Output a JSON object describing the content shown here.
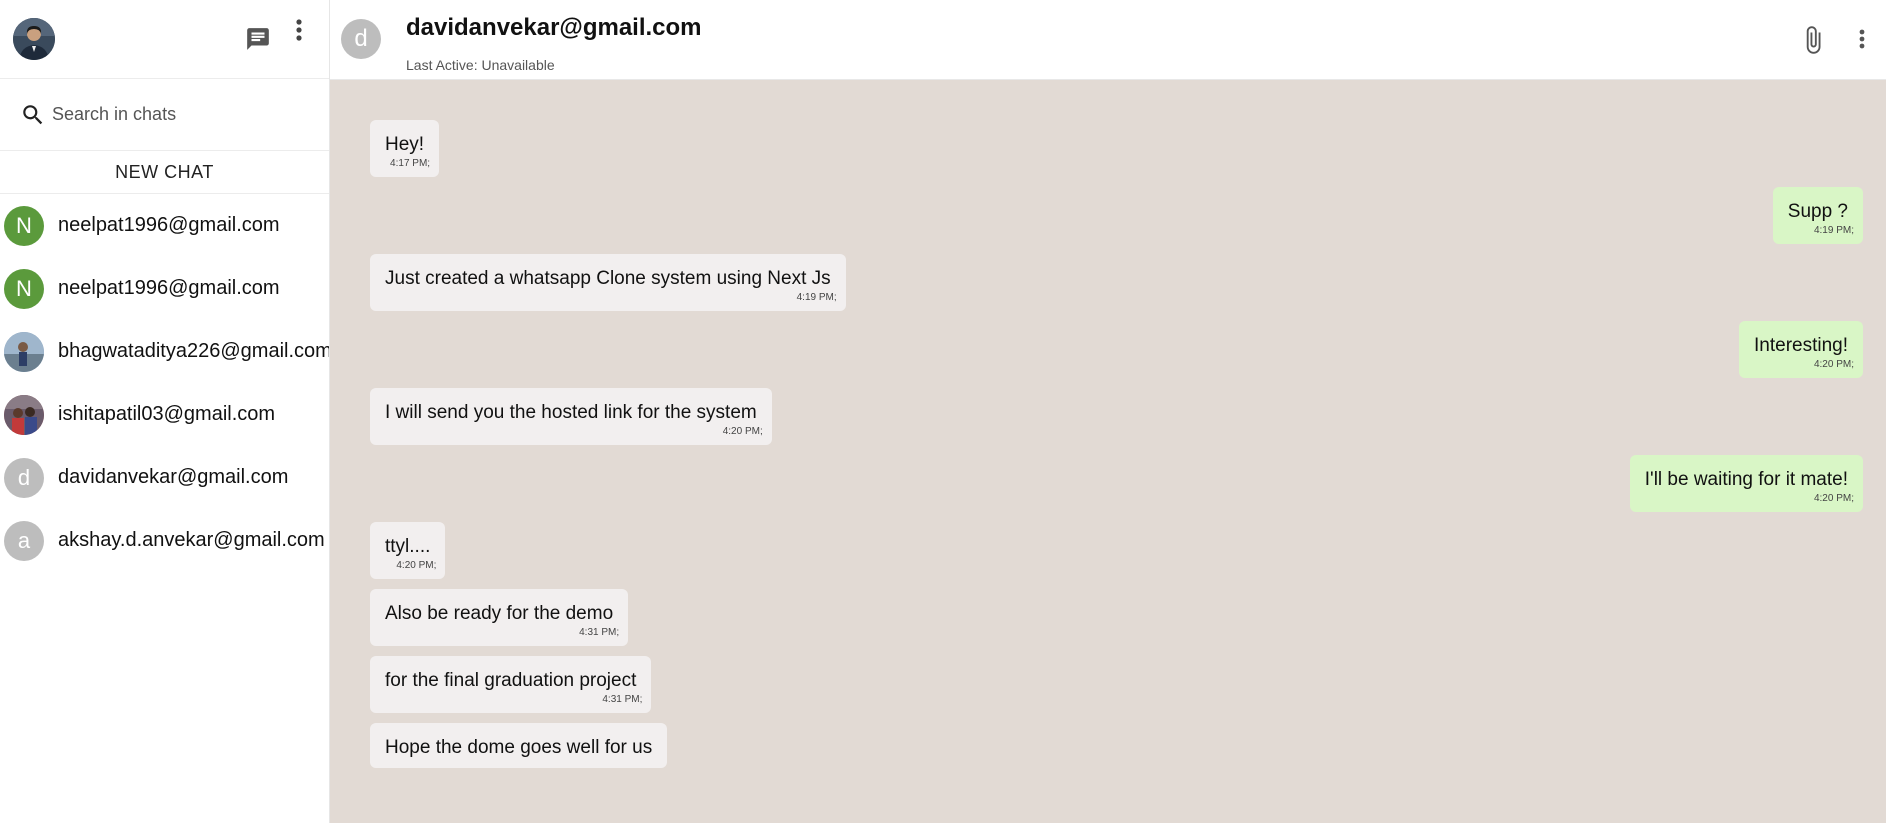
{
  "sidebar": {
    "search_placeholder": "Search in chats",
    "new_chat_label": "NEW CHAT",
    "contacts": [
      {
        "name": "neelpat1996@gmail.com",
        "initial": "N",
        "avatar_type": "letter",
        "color": "#5b9a3c"
      },
      {
        "name": "neelpat1996@gmail.com",
        "initial": "N",
        "avatar_type": "letter",
        "color": "#5b9a3c"
      },
      {
        "name": "bhagwataditya226@gmail.com",
        "initial": "",
        "avatar_type": "photo",
        "color": "#6a8cae"
      },
      {
        "name": "ishitapatil03@gmail.com",
        "initial": "",
        "avatar_type": "photo",
        "color": "#b04a4a"
      },
      {
        "name": "davidanvekar@gmail.com",
        "initial": "d",
        "avatar_type": "letter",
        "color": "#bdbdbd"
      },
      {
        "name": "akshay.d.anvekar@gmail.com",
        "initial": "a",
        "avatar_type": "letter",
        "color": "#bdbdbd"
      }
    ]
  },
  "chat": {
    "avatar_initial": "d",
    "title": "davidanvekar@gmail.com",
    "status": "Last Active: Unavailable",
    "messages": [
      {
        "dir": "in",
        "text": "Hey!",
        "time": "4:17 PM;"
      },
      {
        "dir": "out",
        "text": "Supp ?",
        "time": "4:19 PM;"
      },
      {
        "dir": "in",
        "text": "Just created a whatsapp Clone system using Next Js",
        "time": "4:19 PM;"
      },
      {
        "dir": "out",
        "text": "Interesting!",
        "time": "4:20 PM;"
      },
      {
        "dir": "in",
        "text": "I will send you the hosted link for the system",
        "time": "4:20 PM;"
      },
      {
        "dir": "out",
        "text": "I'll be waiting for it mate!",
        "time": "4:20 PM;"
      },
      {
        "dir": "in",
        "text": "ttyl....",
        "time": "4:20 PM;"
      },
      {
        "dir": "in",
        "text": "Also be ready for the demo",
        "time": "4:31 PM;"
      },
      {
        "dir": "in",
        "text": "for the final graduation project",
        "time": "4:31 PM;"
      },
      {
        "dir": "in",
        "text": "Hope the dome goes well for us",
        "time": ""
      }
    ]
  },
  "colors": {
    "chat_background": "#e2dad4",
    "incoming_bubble": "#f2efef",
    "outgoing_bubble": "#d9f6c6"
  },
  "icons": {
    "new_chat": "chat-bubble-icon",
    "more": "vertical-dots-icon",
    "search": "search-icon",
    "attach": "paperclip-icon"
  }
}
